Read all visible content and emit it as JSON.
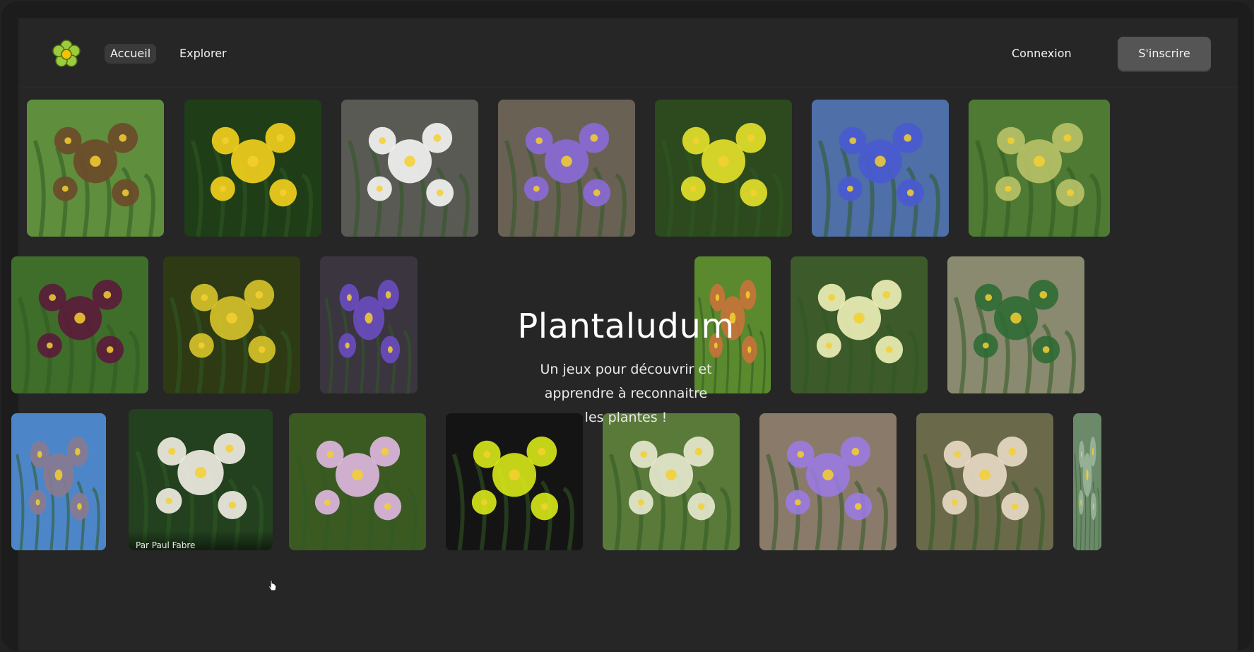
{
  "header": {
    "logo": {
      "name": "flower-logo",
      "colors": {
        "petal": "#9ccc3a",
        "center": "#f5c400",
        "outline": "#4a6b1a"
      }
    },
    "nav": [
      {
        "label": "Accueil",
        "active": true
      },
      {
        "label": "Explorer",
        "active": false
      }
    ],
    "login_label": "Connexion",
    "signup_label": "S'inscrire"
  },
  "hero": {
    "title": "Plantaludum",
    "subtitle_lines": [
      "Un jeux pour découvrir et",
      "apprendre à reconnaitre",
      "les plantes !"
    ]
  },
  "gallery": {
    "credit": "Par Paul Fabre",
    "rows": [
      [
        {
          "subject": "sedge-spike",
          "bg": "#5f8f3c",
          "accent": "#6b4a2a"
        },
        {
          "subject": "yellow-hawkweed",
          "bg": "#1f3d17",
          "accent": "#f4d21d"
        },
        {
          "subject": "white-chickweed",
          "bg": "#5a5a55",
          "accent": "#f5f5f5"
        },
        {
          "subject": "purple-vetch",
          "bg": "#6a6155",
          "accent": "#8a6ad8"
        },
        {
          "subject": "yellow-mustard",
          "bg": "#2c4a1e",
          "accent": "#e6e22a"
        },
        {
          "subject": "blue-borage",
          "bg": "#4e6fa8",
          "accent": "#4a5ad0"
        },
        {
          "subject": "arum-hood",
          "bg": "#4f7a33",
          "accent": "#b8c268"
        }
      ],
      [
        {
          "subject": "dark-orchid",
          "bg": "#3e6e2a",
          "accent": "#5b1a3a"
        },
        {
          "subject": "yellow-rocket",
          "bg": "#2e3a14",
          "accent": "#d8c42a"
        },
        {
          "subject": "purple-lupine",
          "bg": "#3b3540",
          "accent": "#6b4cc0"
        },
        {
          "subject": "leaf-detail",
          "bg": "#5b8a2e",
          "accent": "#c8723a"
        },
        {
          "subject": "pale-clover",
          "bg": "#3c5a2a",
          "accent": "#eef0b8"
        },
        {
          "subject": "green-sprigs",
          "bg": "#8a8a70",
          "accent": "#2f6a34"
        }
      ],
      [
        {
          "subject": "tall-grass",
          "bg": "#4d86c8",
          "accent": "#8a7a90"
        },
        {
          "subject": "white-buckwheat",
          "bg": "#23401f",
          "accent": "#f2f0e4"
        },
        {
          "subject": "pink-soapwort",
          "bg": "#3a5a22",
          "accent": "#e0b8e0"
        },
        {
          "subject": "yellow-wood-sorrel",
          "bg": "#141414",
          "accent": "#d8e818"
        },
        {
          "subject": "white-spike",
          "bg": "#5a7a3a",
          "accent": "#e8ead0"
        },
        {
          "subject": "violet-pansy",
          "bg": "#8a7a6a",
          "accent": "#9a7ae0"
        },
        {
          "subject": "cream-umbel",
          "bg": "#6a6a4a",
          "accent": "#eadcc8"
        },
        {
          "subject": "partial-green",
          "bg": "#6a8a6a",
          "accent": "#9ab49a"
        }
      ]
    ]
  }
}
